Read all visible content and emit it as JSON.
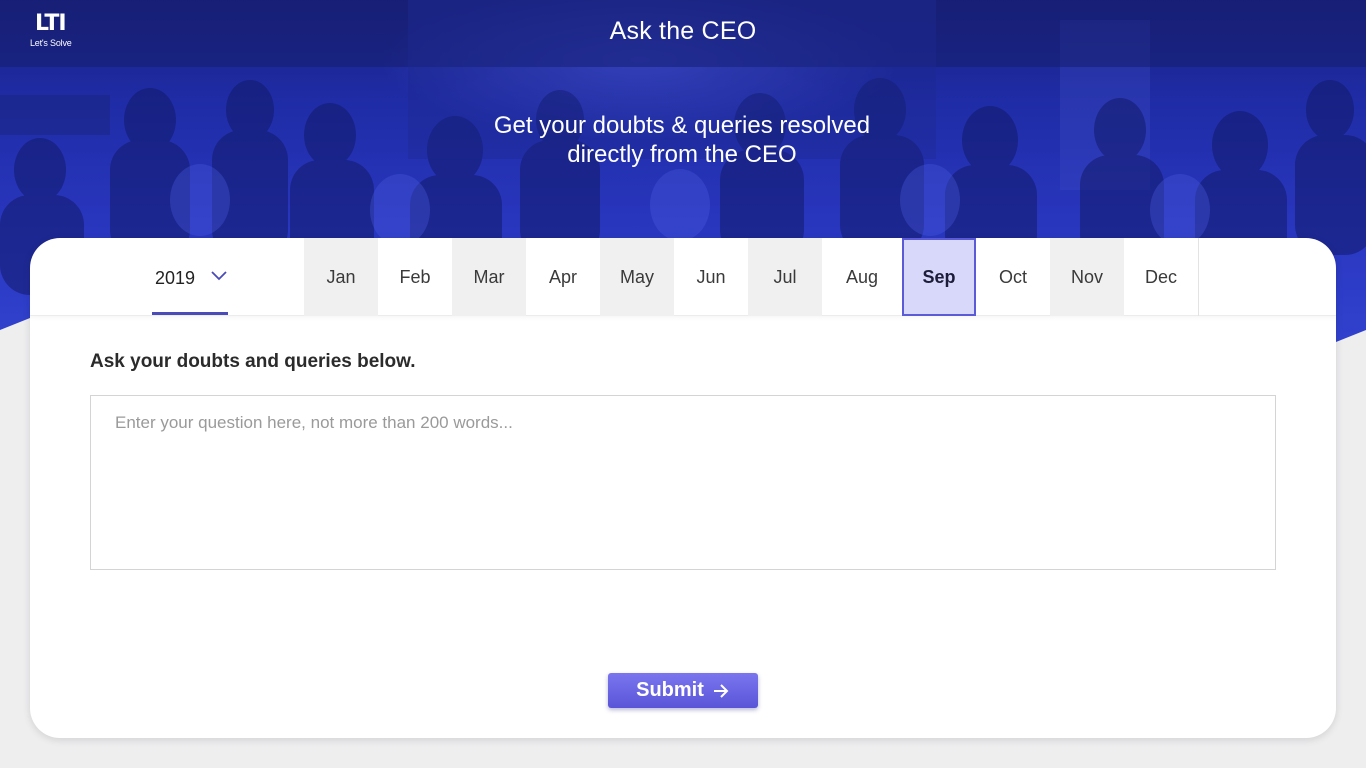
{
  "header": {
    "logo_mark": "LTI",
    "logo_tagline": "Let's Solve",
    "title": "Ask the CEO"
  },
  "hero": {
    "tagline_line1": "Get your doubts & queries resolved",
    "tagline_line2": "directly from the CEO"
  },
  "tabs": {
    "year": {
      "selected": "2019",
      "icon": "chevron-down-icon"
    },
    "months": [
      {
        "label": "Jan",
        "selected": false
      },
      {
        "label": "Feb",
        "selected": false
      },
      {
        "label": "Mar",
        "selected": false
      },
      {
        "label": "Apr",
        "selected": false
      },
      {
        "label": "May",
        "selected": false
      },
      {
        "label": "Jun",
        "selected": false
      },
      {
        "label": "Jul",
        "selected": false
      },
      {
        "label": "Aug",
        "selected": false
      },
      {
        "label": "Sep",
        "selected": true
      },
      {
        "label": "Oct",
        "selected": false
      },
      {
        "label": "Nov",
        "selected": false
      },
      {
        "label": "Dec",
        "selected": false
      }
    ]
  },
  "form": {
    "prompt": "Ask your doubts and queries below.",
    "question_value": "",
    "question_placeholder": "Enter your question here, not more than 200 words...",
    "submit_label": "Submit",
    "submit_icon": "arrow-right-icon"
  },
  "colors": {
    "hero_blue": "#2c3ac8",
    "accent": "#5a55d8",
    "active_tab_bg": "#d8d8fb",
    "page_bg": "#eeeeef"
  }
}
